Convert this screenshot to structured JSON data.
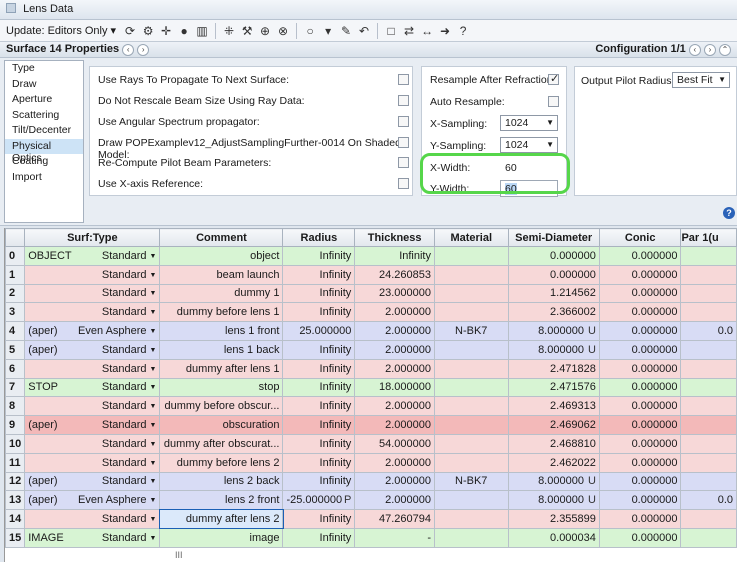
{
  "window": {
    "title": "Lens Data"
  },
  "toolbar": {
    "update_label": "Update: Editors Only ▾"
  },
  "subbar": {
    "surface_title": "Surface 14 Properties",
    "config_title": "Configuration 1/1"
  },
  "sidenav": {
    "items": [
      "Type",
      "Draw",
      "Aperture",
      "Scattering",
      "Tilt/Decenter",
      "Physical Optics",
      "Coating",
      "Import"
    ],
    "selected": "Physical Optics"
  },
  "options": {
    "use_rays": "Use Rays To Propagate To Next Surface:",
    "no_rescale": "Do Not Rescale Beam Size Using Ray Data:",
    "angular": "Use Angular Spectrum propagator:",
    "draw_pop": "Draw POPExamplev12_AdjustSamplingFurther-0014 On Shaded Model:",
    "recompute": "Re-Compute Pilot Beam Parameters:",
    "xaxis": "Use X-axis Reference:"
  },
  "sampling": {
    "resample_label": "Resample After Refraction:",
    "auto_resample_label": "Auto Resample:",
    "x_sampling_label": "X-Sampling:",
    "x_sampling_value": "1024",
    "y_sampling_label": "Y-Sampling:",
    "y_sampling_value": "1024",
    "x_width_label": "X-Width:",
    "x_width_value": "60",
    "y_width_label": "Y-Width:",
    "y_width_value": "60"
  },
  "pilot": {
    "label": "Output Pilot Radius:",
    "value": "Best Fit"
  },
  "table": {
    "headers": [
      "",
      "Surf:Type",
      "Comment",
      "Radius",
      "Thickness",
      "Material",
      "Semi-Diameter",
      "Conic",
      "Par 1(u"
    ],
    "rows": [
      {
        "n": "0",
        "tag": "OBJECT",
        "type": "Standard",
        "comment": "object",
        "radius": "Infinity",
        "thick": "Infinity",
        "mat": "",
        "semi": "0.000000",
        "semi_flag": "",
        "conic": "0.000000",
        "par": ""
      },
      {
        "n": "1",
        "tag": "",
        "type": "Standard",
        "comment": "beam launch",
        "radius": "Infinity",
        "thick": "24.260853",
        "mat": "",
        "semi": "0.000000",
        "semi_flag": "",
        "conic": "0.000000",
        "par": ""
      },
      {
        "n": "2",
        "tag": "",
        "type": "Standard",
        "comment": "dummy 1",
        "radius": "Infinity",
        "thick": "23.000000",
        "mat": "",
        "semi": "1.214562",
        "semi_flag": "",
        "conic": "0.000000",
        "par": ""
      },
      {
        "n": "3",
        "tag": "",
        "type": "Standard",
        "comment": "dummy before lens 1",
        "radius": "Infinity",
        "thick": "2.000000",
        "mat": "",
        "semi": "2.366002",
        "semi_flag": "",
        "conic": "0.000000",
        "par": ""
      },
      {
        "n": "4",
        "tag": "(aper)",
        "type": "Even Asphere",
        "comment": "lens 1 front",
        "radius": "25.000000",
        "thick": "2.000000",
        "mat": "N-BK7",
        "semi": "8.000000",
        "semi_flag": "U",
        "conic": "0.000000",
        "par": "0.0"
      },
      {
        "n": "5",
        "tag": "(aper)",
        "type": "Standard",
        "comment": "lens 1 back",
        "radius": "Infinity",
        "thick": "2.000000",
        "mat": "",
        "semi": "8.000000",
        "semi_flag": "U",
        "conic": "0.000000",
        "par": ""
      },
      {
        "n": "6",
        "tag": "",
        "type": "Standard",
        "comment": "dummy after lens 1",
        "radius": "Infinity",
        "thick": "2.000000",
        "mat": "",
        "semi": "2.471828",
        "semi_flag": "",
        "conic": "0.000000",
        "par": ""
      },
      {
        "n": "7",
        "tag": "STOP",
        "type": "Standard",
        "comment": "stop",
        "radius": "Infinity",
        "thick": "18.000000",
        "mat": "",
        "semi": "2.471576",
        "semi_flag": "",
        "conic": "0.000000",
        "par": ""
      },
      {
        "n": "8",
        "tag": "",
        "type": "Standard",
        "comment": "dummy before obscur...",
        "radius": "Infinity",
        "thick": "2.000000",
        "mat": "",
        "semi": "2.469313",
        "semi_flag": "",
        "conic": "0.000000",
        "par": ""
      },
      {
        "n": "9",
        "tag": "(aper)",
        "type": "Standard",
        "comment": "obscuration",
        "radius": "Infinity",
        "thick": "2.000000",
        "mat": "",
        "semi": "2.469062",
        "semi_flag": "",
        "conic": "0.000000",
        "par": ""
      },
      {
        "n": "10",
        "tag": "",
        "type": "Standard",
        "comment": "dummy after obscurat...",
        "radius": "Infinity",
        "thick": "54.000000",
        "mat": "",
        "semi": "2.468810",
        "semi_flag": "",
        "conic": "0.000000",
        "par": ""
      },
      {
        "n": "11",
        "tag": "",
        "type": "Standard",
        "comment": "dummy before lens 2",
        "radius": "Infinity",
        "thick": "2.000000",
        "mat": "",
        "semi": "2.462022",
        "semi_flag": "",
        "conic": "0.000000",
        "par": ""
      },
      {
        "n": "12",
        "tag": "(aper)",
        "type": "Standard",
        "comment": "lens 2 back",
        "radius": "Infinity",
        "thick": "2.000000",
        "mat": "N-BK7",
        "semi": "8.000000",
        "semi_flag": "U",
        "conic": "0.000000",
        "par": ""
      },
      {
        "n": "13",
        "tag": "(aper)",
        "type": "Even Asphere",
        "comment": "lens 2 front",
        "radius": "-25.000000",
        "radius_flag": "P",
        "thick": "2.000000",
        "mat": "",
        "semi": "8.000000",
        "semi_flag": "U",
        "conic": "0.000000",
        "par": "0.0"
      },
      {
        "n": "14",
        "tag": "",
        "type": "Standard",
        "comment": "dummy after lens 2",
        "radius": "Infinity",
        "thick": "47.260794",
        "mat": "",
        "semi": "2.355899",
        "semi_flag": "",
        "conic": "0.000000",
        "par": ""
      },
      {
        "n": "15",
        "tag": "IMAGE",
        "type": "Standard",
        "comment": "image",
        "radius": "Infinity",
        "thick": "-",
        "mat": "",
        "semi": "0.000034",
        "semi_flag": "",
        "conic": "0.000000",
        "par": ""
      }
    ],
    "row_colors": [
      "g",
      "r",
      "r",
      "r",
      "b",
      "b",
      "r",
      "g",
      "r",
      "rd",
      "r",
      "r",
      "b",
      "b",
      "r",
      "g"
    ],
    "scroll_marker": "III"
  }
}
